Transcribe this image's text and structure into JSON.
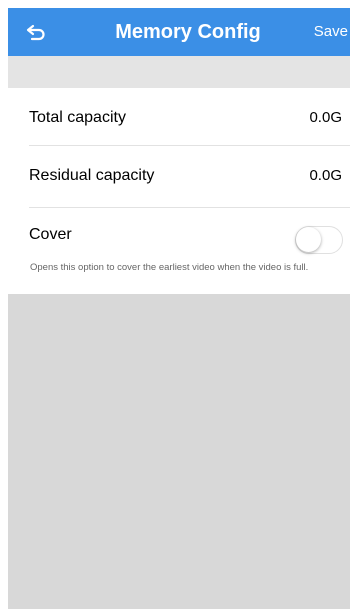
{
  "nav": {
    "title": "Memory Config",
    "save_label": "Save",
    "back_icon": "back-arrow-icon"
  },
  "rows": [
    {
      "label": "Total capacity",
      "value": "0.0G"
    },
    {
      "label": "Residual capacity",
      "value": "0.0G"
    }
  ],
  "cover": {
    "label": "Cover",
    "description": "Opens this option to cover the earliest video when the video is full.",
    "enabled": false
  },
  "colors": {
    "nav_background": "#3b8fe6",
    "band_gray": "#e4e4e4",
    "bottom_gray": "#d8d8d8"
  }
}
